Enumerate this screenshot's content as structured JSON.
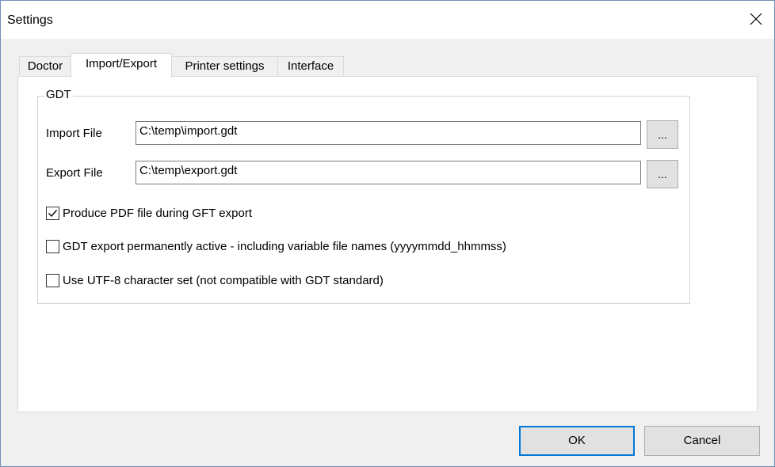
{
  "window": {
    "title": "Settings"
  },
  "tabs": [
    {
      "label": "Doctor"
    },
    {
      "label": "Import/Export"
    },
    {
      "label": "Printer settings"
    },
    {
      "label": "Interface"
    }
  ],
  "active_tab": "Import/Export",
  "gdt_group": {
    "legend": "GDT",
    "import_label": "Import File",
    "import_value": "C:\\temp\\import.gdt",
    "export_label": "Export File",
    "export_value": "C:\\temp\\export.gdt",
    "browse_label": "...",
    "checkboxes": [
      {
        "label": "Produce PDF file during GFT export",
        "checked": true
      },
      {
        "label": "GDT export permanently active - including variable file names (yyyymmdd_hhmmss)",
        "checked": false
      },
      {
        "label": "Use UTF-8 character set (not compatible with GDT standard)",
        "checked": false
      }
    ]
  },
  "buttons": {
    "ok": "OK",
    "cancel": "Cancel"
  },
  "colors": {
    "accent": "#0078d7",
    "window_bg": "#f0f0f0",
    "panel_bg": "#ffffff"
  },
  "icons": {
    "close": "close-icon",
    "check": "checkmark-icon"
  }
}
